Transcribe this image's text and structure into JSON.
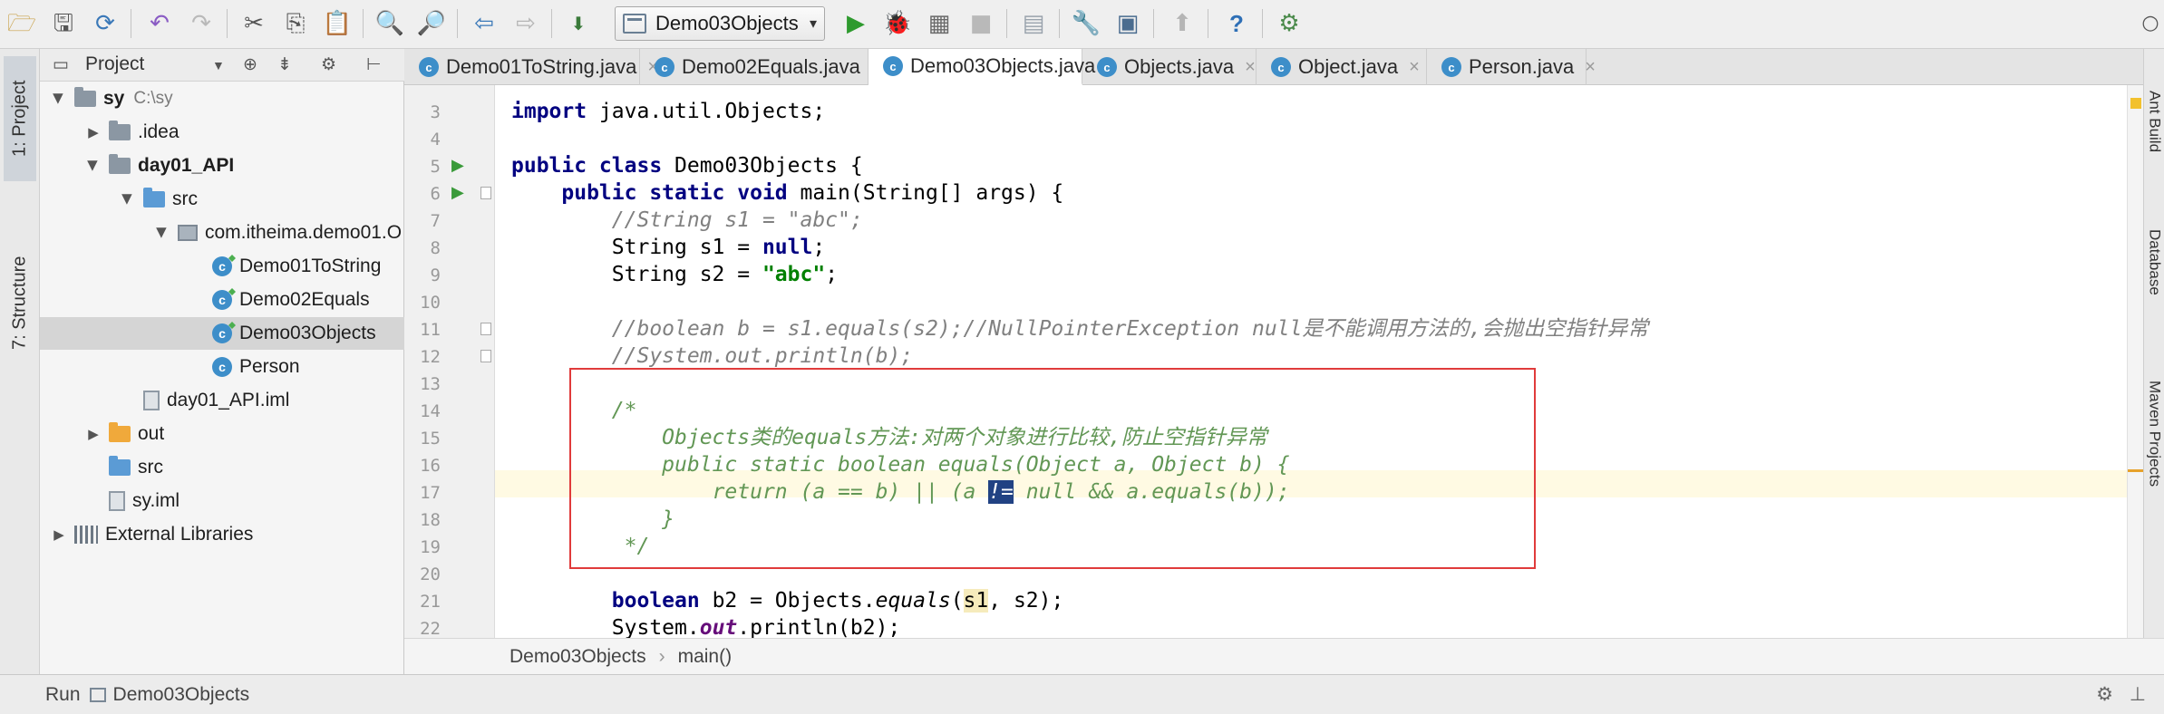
{
  "toolbar": {
    "run_config": "Demo03Objects",
    "icons": [
      "open-folder-icon",
      "save-icon",
      "sync-icon",
      "undo-icon",
      "redo-icon",
      "cut-icon",
      "copy-icon",
      "paste-icon",
      "find-icon",
      "replace-icon",
      "back-icon",
      "forward-icon",
      "build-icon",
      "run-icon",
      "debug-icon",
      "coverage-icon",
      "stop-icon",
      "project-structure-icon",
      "settings-icon",
      "sdk-icon",
      "vcs-icon",
      "help-icon",
      "plugin-icon",
      "search-everywhere-icon"
    ],
    "colors": {
      "run": "#2e9a2e",
      "debug": "#3a8f3a",
      "help": "#2e6fb6",
      "undo": "#8a5cc4"
    }
  },
  "left_strip": {
    "project_tab": "1: Project",
    "structure_tab": "7: Structure"
  },
  "project_panel": {
    "title": "Project",
    "tree": [
      {
        "label": "sy",
        "hint": "C:\\sy",
        "indent": 0,
        "arrow": "open",
        "icon": "folder",
        "bold": true
      },
      {
        "label": ".idea",
        "indent": 1,
        "arrow": "closed",
        "icon": "folder"
      },
      {
        "label": "day01_API",
        "indent": 1,
        "arrow": "open",
        "icon": "folder",
        "bold": true
      },
      {
        "label": "src",
        "indent": 2,
        "arrow": "open",
        "icon": "folder-blue"
      },
      {
        "label": "com.itheima.demo01.O",
        "indent": 3,
        "arrow": "open",
        "icon": "package"
      },
      {
        "label": "Demo01ToString",
        "indent": 4,
        "icon": "class"
      },
      {
        "label": "Demo02Equals",
        "indent": 4,
        "icon": "class"
      },
      {
        "label": "Demo03Objects",
        "indent": 4,
        "icon": "class",
        "selected": true
      },
      {
        "label": "Person",
        "indent": 4,
        "icon": "class-plain"
      },
      {
        "label": "day01_API.iml",
        "indent": 2,
        "icon": "file"
      },
      {
        "label": "out",
        "indent": 1,
        "arrow": "closed",
        "icon": "folder-orange"
      },
      {
        "label": "src",
        "indent": 1,
        "icon": "folder-blue"
      },
      {
        "label": "sy.iml",
        "indent": 1,
        "icon": "file"
      },
      {
        "label": "External Libraries",
        "indent": 0,
        "arrow": "closed",
        "icon": "library"
      }
    ]
  },
  "tabs": [
    {
      "label": "Demo01ToString.java",
      "active": false
    },
    {
      "label": "Demo02Equals.java",
      "active": false
    },
    {
      "label": "Demo03Objects.java",
      "active": true
    },
    {
      "label": "Objects.java",
      "active": false
    },
    {
      "label": "Object.java",
      "active": false
    },
    {
      "label": "Person.java",
      "active": false
    }
  ],
  "editor": {
    "lines": [
      {
        "n": "3",
        "html": "<span class=\"kw\">import</span> java.util.Objects;"
      },
      {
        "n": "4",
        "html": ""
      },
      {
        "n": "5",
        "html": "<span class=\"kw\">public class</span> Demo03Objects {",
        "run": true
      },
      {
        "n": "6",
        "html": "    <span class=\"kw\">public static void</span> main(String[] args) {",
        "run": true,
        "fold": true
      },
      {
        "n": "7",
        "html": "        <span class=\"cmt\">//String s1 = \"abc\";</span>"
      },
      {
        "n": "8",
        "html": "        String s1 = <span class=\"kw\">null</span>;"
      },
      {
        "n": "9",
        "html": "        String s2 = <span class=\"str\">\"abc\"</span>;"
      },
      {
        "n": "10",
        "html": ""
      },
      {
        "n": "11",
        "html": "        <span class=\"cmt\">//boolean b = s1.equals(s2);//NullPointerException null是不能调用方法的,会抛出空指针异常</span>",
        "fold": true
      },
      {
        "n": "12",
        "html": "        <span class=\"cmt\">//System.out.println(b);</span>",
        "fold": true
      },
      {
        "n": "13",
        "html": ""
      },
      {
        "n": "14",
        "html": "        <span class=\"doc\">/*</span>"
      },
      {
        "n": "15",
        "html": "            <span class=\"doc\">Objects类的equals方法:对两个对象进行比较,防止空指针异常</span>"
      },
      {
        "n": "16",
        "html": "            <span class=\"doc\">public static boolean equals(Object a, Object b) {</span>"
      },
      {
        "n": "17",
        "html": "                <span class=\"doc\">return (a == b) || (a <span class=\"selsel\">!=</span> null &amp;&amp; a.equals(b));</span>",
        "current": true
      },
      {
        "n": "18",
        "html": "            <span class=\"doc\">}</span>"
      },
      {
        "n": "19",
        "html": "         <span class=\"doc\">*/</span>"
      },
      {
        "n": "20",
        "html": ""
      },
      {
        "n": "21",
        "html": "        <span class=\"kw\">boolean</span> b2 = Objects.<span class=\"mth\">equals</span>(<span class=\"hl-var\">s1</span>, s2);"
      },
      {
        "n": "22",
        "html": "        System.<span class=\"fld\">out</span>.println(b2);"
      }
    ]
  },
  "breadcrumb": {
    "class": "Demo03Objects",
    "method": "main()"
  },
  "statusbar": {
    "run_label": "Run",
    "run_target": "Demo03Objects"
  },
  "right_strip": {
    "labels": [
      "Ant Build",
      "Database",
      "Maven Projects"
    ]
  }
}
